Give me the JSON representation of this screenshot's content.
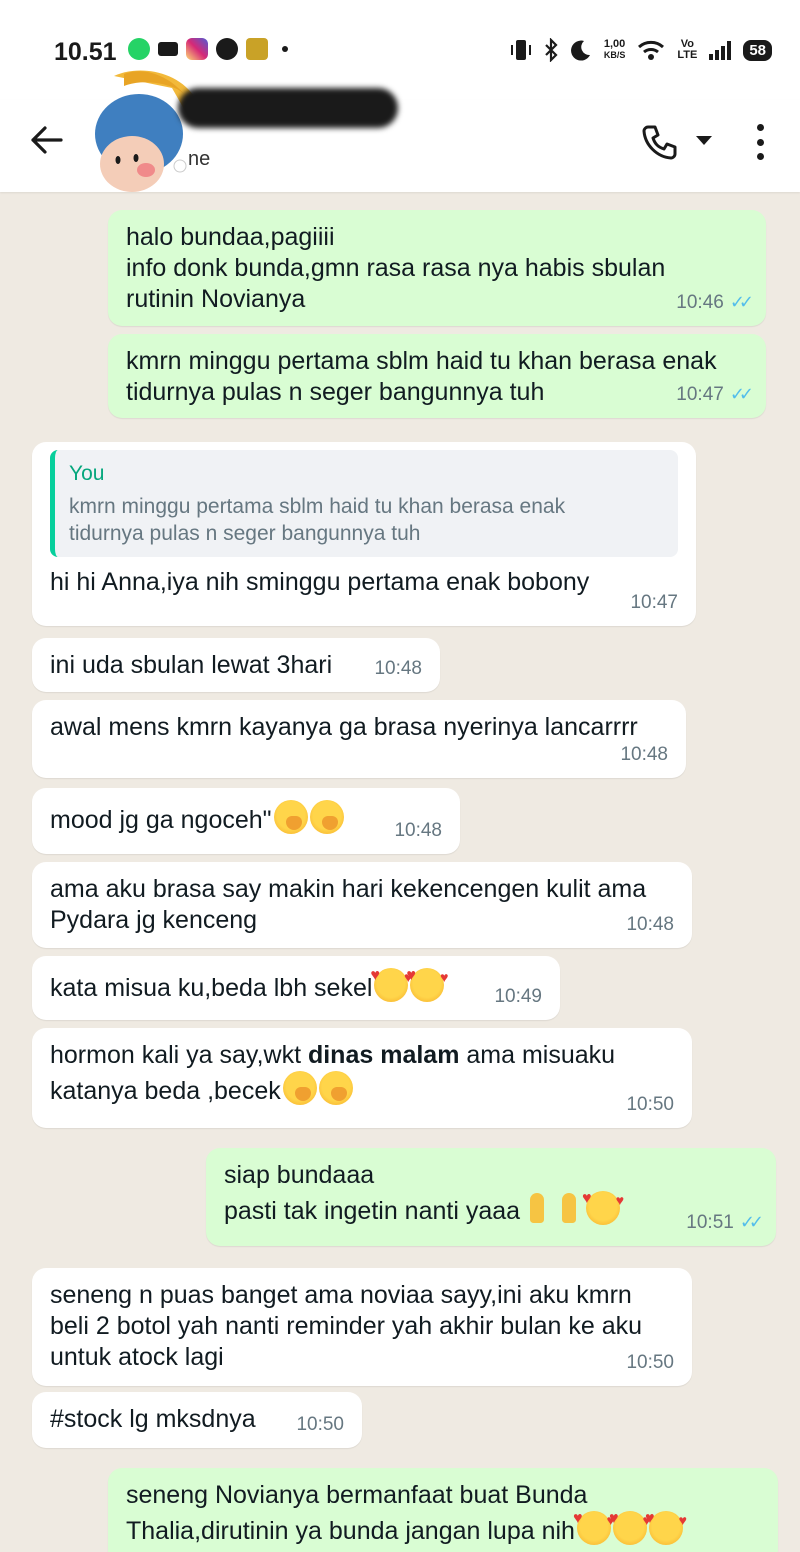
{
  "status_bar": {
    "time": "10.51",
    "net_speed_value": "1,00",
    "net_speed_unit": "KB/S",
    "volte": "Vo\nLTE",
    "battery": "58"
  },
  "header": {
    "contact_subtitle": "ne"
  },
  "messages": [
    {
      "dir": "out",
      "text": "halo bundaa,pagiiii\ninfo donk bunda,gmn rasa rasa nya habis sbulan\nrutinin Novianya",
      "time": "10:46"
    },
    {
      "dir": "out",
      "text": "kmrn minggu pertama sblm haid tu khan berasa enak\ntidurnya pulas n seger bangunnya tuh",
      "time": "10:47"
    },
    {
      "dir": "in",
      "quote_author": "You",
      "quote_text": "kmrn minggu pertama sblm haid tu khan berasa enak\ntidurnya pulas n seger bangunnya tuh",
      "text": "hi hi Anna,iya nih sminggu pertama enak bobony",
      "time": "10:47"
    },
    {
      "dir": "in",
      "text": "ini uda sbulan lewat 3hari",
      "time": "10:48"
    },
    {
      "dir": "in",
      "text": "awal mens kmrn kayanya ga brasa nyerinya lancarrrr",
      "time": "10:48"
    },
    {
      "dir": "in",
      "text": "mood jg ga ngoceh\"",
      "time": "10:48"
    },
    {
      "dir": "in",
      "text": "ama aku brasa say makin hari kekencengen kulit ama\nPydara jg kenceng",
      "time": "10:48"
    },
    {
      "dir": "in",
      "text": "kata misua ku,beda lbh sekel",
      "time": "10:49"
    },
    {
      "dir": "in",
      "text_a": "hormon kali ya say,wkt ",
      "text_bold": "dinas malam",
      "text_b": " ama misuaku\nkatanya beda ,becek",
      "time": "10:50"
    },
    {
      "dir": "out",
      "text": "siap bundaaa\npasti tak ingetin nanti yaaa",
      "time": "10:51"
    },
    {
      "dir": "in",
      "text": "seneng n puas banget ama noviaa sayy,ini aku kmrn\nbeli 2 botol yah nanti reminder yah akhir bulan ke aku\nuntuk atock lagi",
      "time": "10:50"
    },
    {
      "dir": "in",
      "text": "#stock lg mksdnya",
      "time": "10:50"
    },
    {
      "dir": "out",
      "text": "seneng Novianya bermanfaat buat Bunda\nThalia,dirutinin ya bunda jangan lupa nih",
      "time": ""
    }
  ],
  "icons": {
    "back": "arrow-left-icon",
    "call": "phone-icon",
    "menu": "more-vert-icon",
    "read": "double-check-icon"
  },
  "colors": {
    "outgoing_bubble": "#d9fdd3",
    "incoming_bubble": "#ffffff",
    "chat_background": "#efeae2",
    "read_ticks": "#53bdeb",
    "quote_accent": "#06cf9c"
  }
}
